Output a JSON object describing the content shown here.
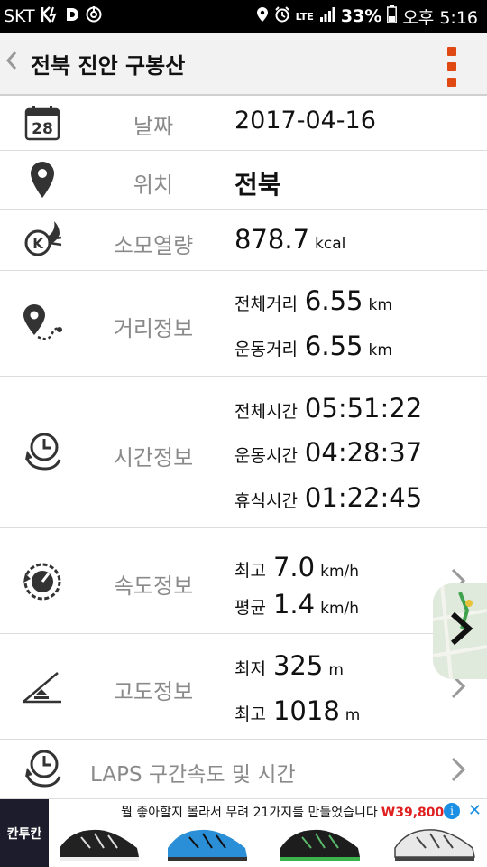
{
  "status_bar": {
    "carrier": "SKT",
    "left_icons": [
      "lte-boost-icon",
      "d-app-icon",
      "power-saver-icon"
    ],
    "right_icons": [
      "location-icon",
      "alarm-icon",
      "lte-icon",
      "signal-icon",
      "battery-icon"
    ],
    "lte": "LTE",
    "battery": "33%",
    "time": "오후 5:16"
  },
  "header": {
    "title": "전북 진안 구봉산"
  },
  "rows": {
    "date": {
      "label": "날짜",
      "value": "2017-04-16",
      "calendar_day": "28"
    },
    "location": {
      "label": "위치",
      "value": "전북"
    },
    "calories": {
      "label": "소모열량",
      "value": "878.7",
      "unit": "kcal"
    },
    "distance": {
      "label": "거리정보",
      "total_label": "전체거리",
      "total_value": "6.55",
      "total_unit": "km",
      "moving_label": "운동거리",
      "moving_value": "6.55",
      "moving_unit": "km"
    },
    "time": {
      "label": "시간정보",
      "total_label": "전체시간",
      "total_value": "05:51:22",
      "moving_label": "운동시간",
      "moving_value": "04:28:37",
      "rest_label": "휴식시간",
      "rest_value": "01:22:45"
    },
    "speed": {
      "label": "속도정보",
      "max_label": "최고",
      "max_value": "7.0",
      "max_unit": "km/h",
      "avg_label": "평균",
      "avg_value": "1.4",
      "avg_unit": "km/h"
    },
    "altitude": {
      "label": "고도정보",
      "min_label": "최저",
      "min_value": "325",
      "min_unit": "m",
      "max_label": "최고",
      "max_value": "1018",
      "max_unit": "m"
    },
    "laps": {
      "label": "LAPS 구간속도 및 시간"
    }
  },
  "ad": {
    "logo": "칸투칸",
    "text": "뭘 좋아할지 몰라서 무려 21가지를 만들었습니다",
    "price": "W39,800",
    "info": "i",
    "close": "✕"
  },
  "colors": {
    "accent": "#e04a12",
    "label_gray": "#8a8a8a",
    "divider": "#dcdcdc",
    "ad_info_blue": "#1a8fe3"
  }
}
